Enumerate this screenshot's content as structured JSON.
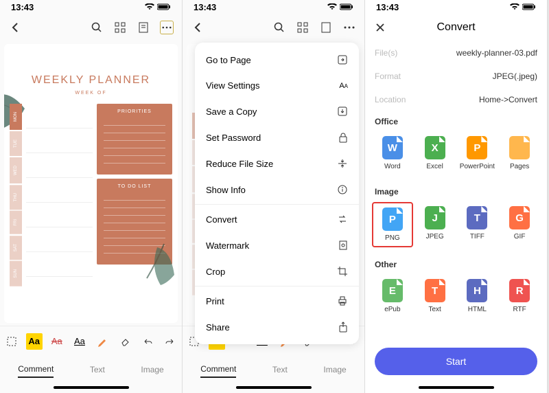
{
  "status": {
    "time": "13:43"
  },
  "planner": {
    "title": "WEEKLY PLANNER",
    "subtitle": "WEEK OF",
    "days": [
      "MON",
      "TUE",
      "WED",
      "THU",
      "FRI",
      "SAT",
      "SUN"
    ],
    "card1": "PRIORITIES",
    "card2": "TO DO LIST"
  },
  "tabs": {
    "comment": "Comment",
    "text": "Text",
    "image": "Image"
  },
  "menu": {
    "goto": "Go to Page",
    "view": "View Settings",
    "save": "Save a Copy",
    "password": "Set Password",
    "reduce": "Reduce File Size",
    "info": "Show Info",
    "convert": "Convert",
    "watermark": "Watermark",
    "crop": "Crop",
    "print": "Print",
    "share": "Share"
  },
  "convert": {
    "title": "Convert",
    "files_label": "File(s)",
    "files_val": "weekly-planner-03.pdf",
    "format_label": "Format",
    "format_val": "JPEG(.jpeg)",
    "location_label": "Location",
    "location_val": "Home->Convert",
    "section_office": "Office",
    "section_image": "Image",
    "section_other": "Other",
    "start": "Start",
    "formats": {
      "word": "Word",
      "excel": "Excel",
      "ppt": "PowerPoint",
      "pages": "Pages",
      "png": "PNG",
      "jpeg": "JPEG",
      "tiff": "TIFF",
      "gif": "GIF",
      "epub": "ePub",
      "text": "Text",
      "html": "HTML",
      "rtf": "RTF"
    },
    "letters": {
      "word": "W",
      "excel": "X",
      "ppt": "P",
      "pages": "",
      "png": "P",
      "jpeg": "J",
      "tiff": "T",
      "gif": "G",
      "epub": "E",
      "text": "T",
      "html": "H",
      "rtf": "R"
    }
  }
}
